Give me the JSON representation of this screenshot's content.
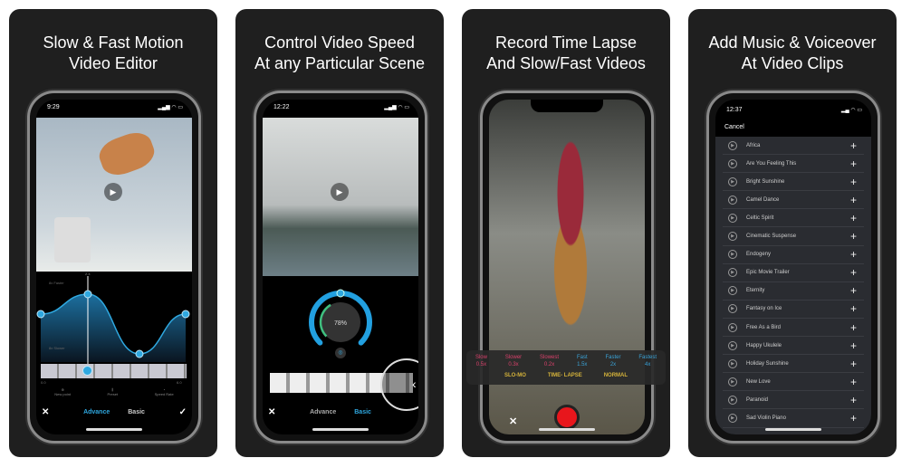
{
  "panels": [
    {
      "title1": "Slow & Fast Motion",
      "title2": "Video Editor",
      "time": "9:29",
      "graph": {
        "top_label": "8x Faster",
        "bottom_label": "8x Slower",
        "time_start": "0.0",
        "time_marker": "2.4",
        "time_end": "6.0",
        "speed_points": [
          0.3,
          0.5,
          -0.1,
          0.3
        ],
        "playhead": 0.33
      },
      "tools": [
        "New point",
        "Preset",
        "Speed Rate"
      ],
      "tabs": [
        "Advance",
        "Basic"
      ],
      "active_tab": "Advance"
    },
    {
      "title1": "Control Video Speed",
      "title2": "At any Particular Scene",
      "time": "12:22",
      "dial_value": "78%",
      "dial_progress": 0.78,
      "tabs": [
        "Advance",
        "Basic"
      ],
      "active_tab": "Basic"
    },
    {
      "title1": "Record Time Lapse",
      "title2": "And Slow/Fast Videos",
      "speeds": [
        {
          "name": "Slow",
          "value": "0.5x",
          "color": "#d9416b"
        },
        {
          "name": "Slower",
          "value": "0.3x",
          "color": "#d9416b"
        },
        {
          "name": "Slowest",
          "value": "0.2x",
          "color": "#d9416b"
        },
        {
          "name": "Fast",
          "value": "1.5x",
          "color": "#3aa3d8"
        },
        {
          "name": "Faster",
          "value": "2x",
          "color": "#3aa3d8"
        },
        {
          "name": "Fastest",
          "value": "4x",
          "color": "#3aa3d8"
        }
      ],
      "modes": [
        "SLO-MO",
        "TIME- LAPSE",
        "NORMAL"
      ]
    },
    {
      "title1": "Add Music & Voiceover",
      "title2": "At Video Clips",
      "time": "12:37",
      "cancel": "Cancel",
      "songs": [
        "Africa",
        "Are You Feeling This",
        "Bright Sunshine",
        "Camel Dance",
        "Celtic Spirit",
        "Cinematic Suspense",
        "Endogeny",
        "Epic Movie Trailer",
        "Eternity",
        "Fantasy on Ice",
        "Free As a Bird",
        "Happy Ukulele",
        "Holiday Sunshine",
        "New Love",
        "Paranoid",
        "Sad Violin  Piano"
      ]
    }
  ],
  "colors": {
    "accent": "#2fa8e0",
    "mode": "#d4b23a",
    "record": "#e8161c"
  }
}
